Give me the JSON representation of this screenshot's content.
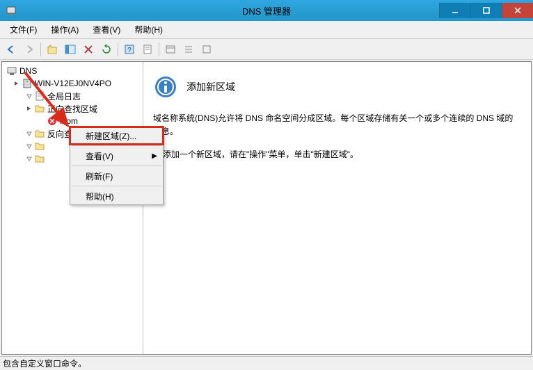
{
  "window": {
    "title": "DNS 管理器"
  },
  "menubar": [
    "文件(F)",
    "操作(A)",
    "查看(V)",
    "帮助(H)"
  ],
  "tree": {
    "root": "DNS",
    "server": "WIN-V12EJ0NV4PO",
    "global_log": "全局日志",
    "fwd": "正向查找区域",
    "zone1": ".com",
    "bwd": "反向查找区域"
  },
  "contextMenu": {
    "newZone": "新建区域(Z)...",
    "view": "查看(V)",
    "refresh": "刷新(F)",
    "help": "帮助(H)"
  },
  "content": {
    "heading": "添加新区域",
    "para1": "域名称系统(DNS)允许将 DNS 命名空间分成区域。每个区域存储有关一个或多个连续的 DNS 域的信息。",
    "para2": "添加一个新区域，请在\"操作\"菜单，单击\"新建区域\"。"
  },
  "status": "包含自定义窗口命令。"
}
